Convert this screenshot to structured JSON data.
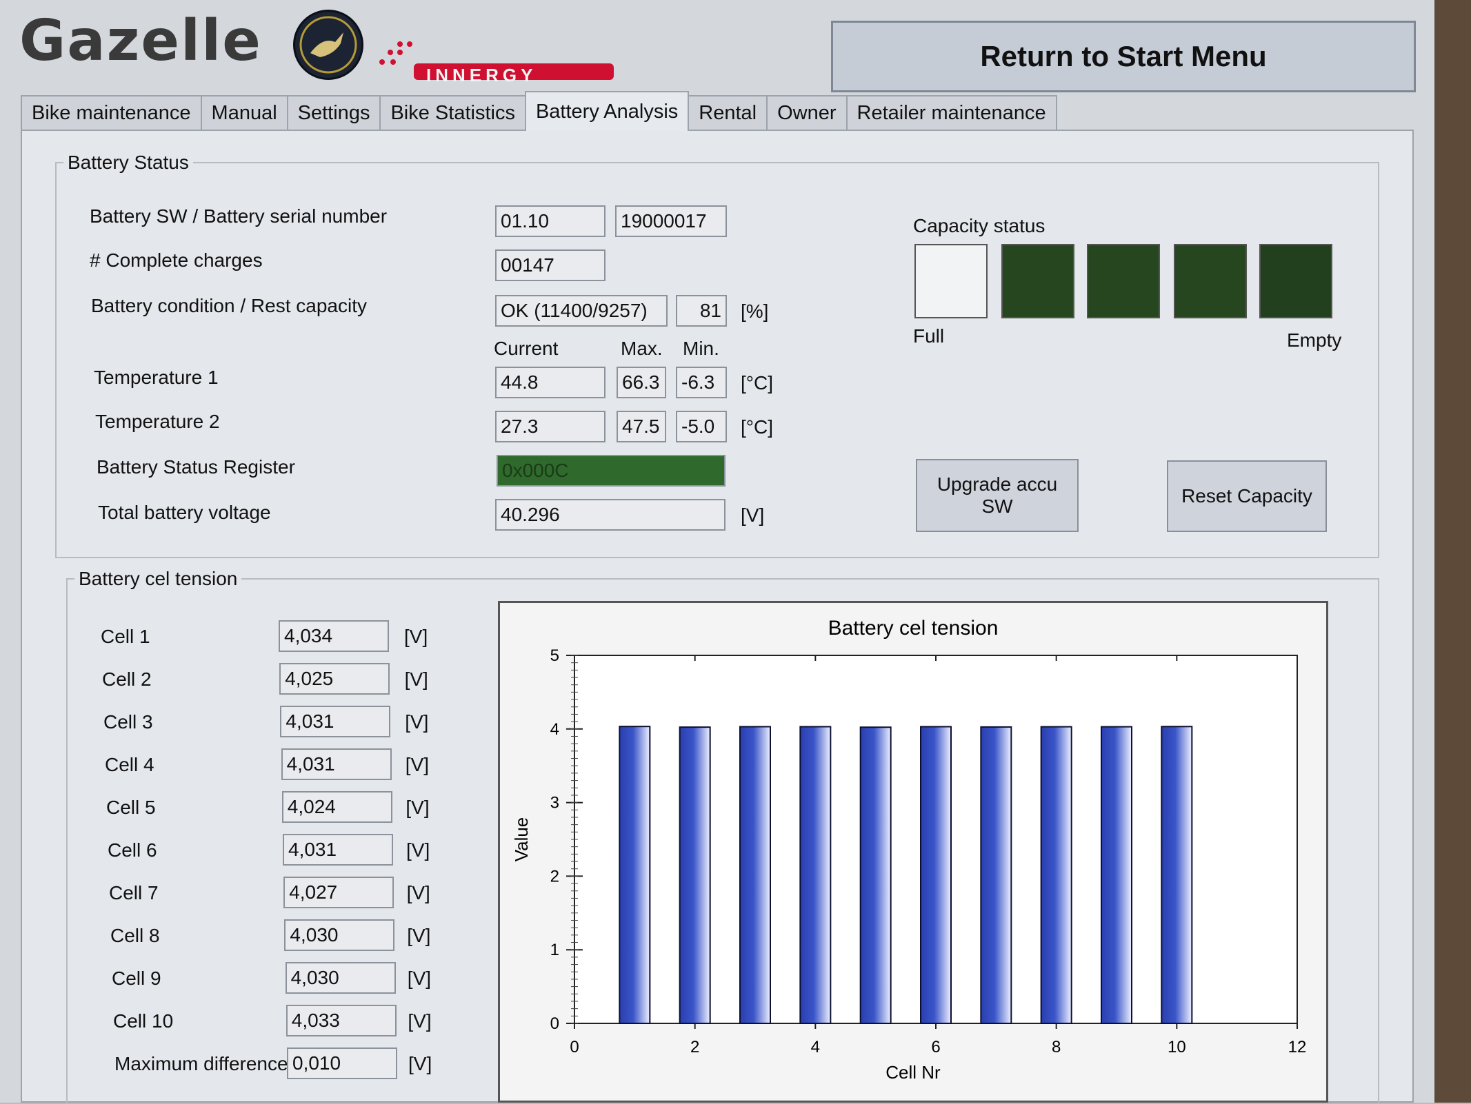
{
  "header": {
    "logo_text": "Gazelle",
    "brand_sub": "innergy",
    "return_button": "Return to Start Menu"
  },
  "tabs": [
    {
      "label": "Bike maintenance",
      "active": false
    },
    {
      "label": "Manual",
      "active": false
    },
    {
      "label": "Settings",
      "active": false
    },
    {
      "label": "Bike Statistics",
      "active": false
    },
    {
      "label": "Battery Analysis",
      "active": true
    },
    {
      "label": "Rental",
      "active": false
    },
    {
      "label": "Owner",
      "active": false
    },
    {
      "label": "Retailer maintenance",
      "active": false
    }
  ],
  "battery_status": {
    "legend": "Battery Status",
    "sw_serial_label": "Battery SW / Battery serial number",
    "sw_value": "01.10",
    "serial_value": "19000017",
    "charges_label": "# Complete charges",
    "charges_value": "00147",
    "condition_label": "Battery condition / Rest capacity",
    "condition_value": "OK (11400/9257)",
    "rest_capacity_value": "81",
    "percent_unit": "[%]",
    "col_current": "Current",
    "col_max": "Max.",
    "col_min": "Min.",
    "temp1_label": "Temperature 1",
    "temp1_current": "44.8",
    "temp1_max": "66.3",
    "temp1_min": "-6.3",
    "temp2_label": "Temperature 2",
    "temp2_current": "27.3",
    "temp2_max": "47.5",
    "temp2_min": "-5.0",
    "celsius_unit": "[°C]",
    "register_label": "Battery Status Register",
    "register_value": "0x000C",
    "register_color": "#2f6a2c",
    "voltage_label": "Total battery voltage",
    "voltage_value": "40.296",
    "volt_unit": "[V]"
  },
  "capacity": {
    "title": "Capacity status",
    "full_label": "Full",
    "empty_label": "Empty",
    "boxes": [
      {
        "color": "#f2f3f5"
      },
      {
        "color": "#26461f"
      },
      {
        "color": "#26461f"
      },
      {
        "color": "#26461f"
      },
      {
        "color": "#22401d"
      }
    ]
  },
  "buttons": {
    "upgrade": "Upgrade accu SW",
    "reset": "Reset Capacity"
  },
  "cells": {
    "legend": "Battery cel tension",
    "unit": "[V]",
    "items": [
      {
        "label": "Cell 1",
        "value": "4,034"
      },
      {
        "label": "Cell 2",
        "value": "4,025"
      },
      {
        "label": "Cell 3",
        "value": "4,031"
      },
      {
        "label": "Cell 4",
        "value": "4,031"
      },
      {
        "label": "Cell 5",
        "value": "4,024"
      },
      {
        "label": "Cell 6",
        "value": "4,031"
      },
      {
        "label": "Cell 7",
        "value": "4,027"
      },
      {
        "label": "Cell 8",
        "value": "4,030"
      },
      {
        "label": "Cell 9",
        "value": "4,030"
      },
      {
        "label": "Cell 10",
        "value": "4,033"
      }
    ],
    "max_diff_label": "Maximum difference",
    "max_diff_value": "0,010"
  },
  "chart_data": {
    "type": "bar",
    "title": "Battery cel tension",
    "xlabel": "Cell Nr",
    "ylabel": "Value",
    "x": [
      1,
      2,
      3,
      4,
      5,
      6,
      7,
      8,
      9,
      10
    ],
    "values": [
      4.034,
      4.025,
      4.031,
      4.031,
      4.024,
      4.031,
      4.027,
      4.03,
      4.03,
      4.033
    ],
    "xlim": [
      0,
      12
    ],
    "ylim": [
      0,
      5
    ],
    "x_ticks": [
      0,
      2,
      4,
      6,
      8,
      10,
      12
    ],
    "y_ticks": [
      0,
      1,
      2,
      3,
      4,
      5
    ],
    "grid": false,
    "legend": "none",
    "bar_color": "#3a55c8"
  }
}
